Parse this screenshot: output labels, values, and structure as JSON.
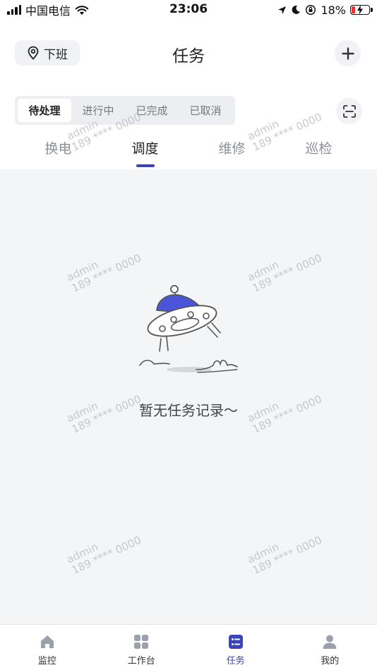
{
  "status_bar": {
    "carrier": "中国电信",
    "time": "23:06",
    "battery": "18%"
  },
  "header": {
    "offduty_label": "下班",
    "title": "任务"
  },
  "status_segment": [
    {
      "label": "待处理",
      "active": true
    },
    {
      "label": "进行中",
      "active": false
    },
    {
      "label": "已完成",
      "active": false
    },
    {
      "label": "已取消",
      "active": false
    }
  ],
  "category_tabs": [
    {
      "label": "换电",
      "active": false
    },
    {
      "label": "调度",
      "active": true
    },
    {
      "label": "维修",
      "active": false
    },
    {
      "label": "巡检",
      "active": false
    }
  ],
  "empty_state": {
    "message": "暂无任务记录～"
  },
  "watermark": {
    "user": "admin",
    "phone": "189 **** 0000"
  },
  "bottom_nav": [
    {
      "label": "监控",
      "icon": "home-icon",
      "active": false
    },
    {
      "label": "工作台",
      "icon": "grid-icon",
      "active": false
    },
    {
      "label": "任务",
      "icon": "task-list-icon",
      "active": true
    },
    {
      "label": "我的",
      "icon": "person-icon",
      "active": false
    }
  ],
  "colors": {
    "accent": "#3c44b9",
    "ufo_dome": "#4a55d9",
    "background": "#f4f5f7"
  }
}
